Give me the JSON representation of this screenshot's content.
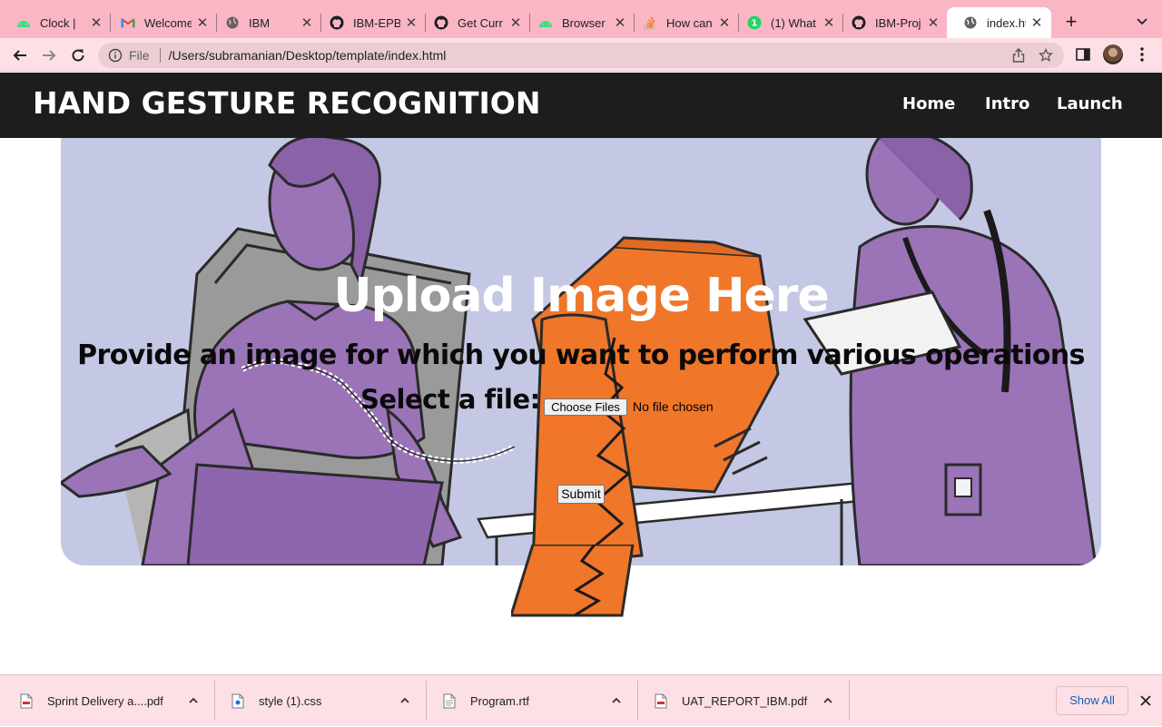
{
  "tabs": [
    {
      "title": "Clock |",
      "icon": "android-clock-icon",
      "active": false
    },
    {
      "title": "Welcome",
      "icon": "gmail-icon",
      "active": false
    },
    {
      "title": "IBM",
      "icon": "globe-icon",
      "active": false
    },
    {
      "title": "IBM-EPB",
      "icon": "github-icon",
      "active": false
    },
    {
      "title": "Get Curr",
      "icon": "github-icon",
      "active": false
    },
    {
      "title": "Browser",
      "icon": "android-icon",
      "active": false
    },
    {
      "title": "How can",
      "icon": "stackoverflow-icon",
      "active": false
    },
    {
      "title": "(1) What",
      "icon": "whatsapp-icon",
      "active": false
    },
    {
      "title": "IBM-Proj",
      "icon": "github-icon",
      "active": false
    },
    {
      "title": "index.htm",
      "icon": "globe-icon",
      "active": true
    }
  ],
  "address_bar": {
    "scheme": "File",
    "url": "/Users/subramanian/Desktop/template/index.html"
  },
  "site": {
    "brand": "HAND GESTURE RECOGNITION",
    "nav": [
      "Home",
      "Intro",
      "Launch"
    ]
  },
  "hero": {
    "title": "Upload Image Here",
    "subtitle": "Provide an image for which you want to perform various operations",
    "select_label": "Select a file:",
    "file_button": "Choose Files",
    "file_status": "No file chosen",
    "submit": "Submit"
  },
  "downloads": {
    "items": [
      {
        "name": "Sprint Delivery a....pdf",
        "icon": "pdf-file-icon"
      },
      {
        "name": "style (1).css",
        "icon": "css-file-icon"
      },
      {
        "name": "Program.rtf",
        "icon": "rtf-file-icon"
      },
      {
        "name": "UAT_REPORT_IBM.pdf",
        "icon": "pdf-file-icon"
      }
    ],
    "show_all": "Show All"
  },
  "colors": {
    "tabstrip": "#fbb6c6",
    "toolbar": "#fde0e6",
    "site_nav": "#1d1d1d",
    "hero_bg": "#c5c8e4",
    "illustration_purple": "#9b73b7",
    "illustration_orange": "#f0762a",
    "link_blue": "#1a5fb4"
  }
}
